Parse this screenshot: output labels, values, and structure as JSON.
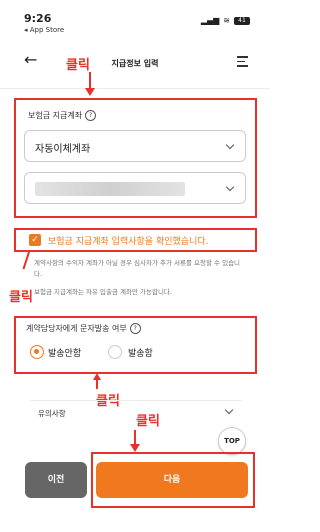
{
  "status_bar": {
    "time": "9:26",
    "back_app": "◂ App Store",
    "battery": "41"
  },
  "header": {
    "title": "지급정보 입력"
  },
  "annotation": {
    "click_label": "클릭",
    "color": "#e8312a"
  },
  "account_section": {
    "label": "보험금 지급계좌",
    "method_value": "자동이체계좌",
    "account_value": ""
  },
  "confirm": {
    "checked": true,
    "label": "보험금 지급계좌 입력사항을 확인했습니다.",
    "notes": [
      "계약사항의 수익자 계좌가 아닐 경우 심사자가 추가 서류를 요청할 수 있습니다.",
      "보험금 지급계좌는 자유 입출금 계좌만 가능합니다."
    ]
  },
  "sms_section": {
    "label": "계약담당자에게 문자발송 여부",
    "options": [
      {
        "label": "발송안함",
        "selected": true
      },
      {
        "label": "발송함",
        "selected": false
      }
    ]
  },
  "notice": {
    "label": "유의사항"
  },
  "top_button": "TOP",
  "footer": {
    "prev_label": "이전",
    "next_label": "다음"
  },
  "colors": {
    "accent": "#f0781e",
    "annotation": "#e8312a",
    "prev_button": "#666666"
  }
}
